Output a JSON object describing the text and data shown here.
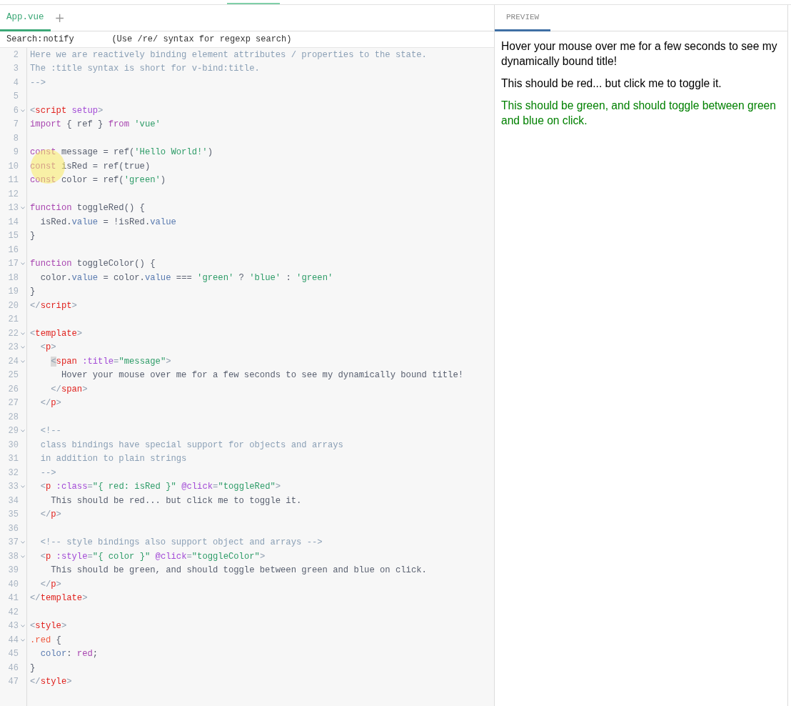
{
  "editor": {
    "tabs": [
      {
        "label": "App.vue",
        "selected": true
      }
    ],
    "add_tab": "+",
    "search": {
      "label": "Search:",
      "value": "notify",
      "hint": "(Use /re/ syntax for regexp search)"
    },
    "lines": [
      {
        "number": "2",
        "foldable": false,
        "tokens": [
          {
            "kind": "comment",
            "text": "Here we are reactively binding element attributes / properties to the state."
          }
        ]
      },
      {
        "number": "3",
        "foldable": false,
        "tokens": [
          {
            "kind": "comment",
            "text": "The :title syntax is short for v-bind:title."
          }
        ]
      },
      {
        "number": "4",
        "foldable": false,
        "tokens": [
          {
            "kind": "comment",
            "text": "-->"
          }
        ]
      },
      {
        "number": "5",
        "foldable": false
      },
      {
        "number": "6",
        "foldable": true,
        "tokens": [
          {
            "kind": "bracket",
            "text": "<"
          },
          {
            "kind": "tag",
            "text": "script"
          },
          {
            "kind": "attr",
            "text": " setup"
          },
          {
            "kind": "bracket",
            "text": ">"
          }
        ]
      },
      {
        "number": "7",
        "foldable": false,
        "tokens": [
          {
            "kind": "keyword",
            "text": "import"
          },
          {
            "kind": "plain",
            "text": " { ref } "
          },
          {
            "kind": "keyword",
            "text": "from"
          },
          {
            "kind": "string",
            "text": " 'vue'"
          }
        ]
      },
      {
        "number": "8",
        "foldable": false
      },
      {
        "number": "9",
        "foldable": false,
        "tokens": [
          {
            "kind": "keyword",
            "text": "const"
          },
          {
            "kind": "plain",
            "text": " message = ref("
          },
          {
            "kind": "string",
            "text": "'Hello World!'"
          },
          {
            "kind": "plain",
            "text": ")"
          }
        ]
      },
      {
        "number": "10",
        "foldable": false,
        "tokens": [
          {
            "kind": "keyword",
            "text": "const"
          },
          {
            "kind": "plain",
            "text": " isRed = ref(true)"
          }
        ]
      },
      {
        "number": "11",
        "foldable": false,
        "tokens": [
          {
            "kind": "keyword",
            "text": "const"
          },
          {
            "kind": "plain",
            "text": " color = ref("
          },
          {
            "kind": "string",
            "text": "'green'"
          },
          {
            "kind": "plain",
            "text": ")"
          }
        ]
      },
      {
        "number": "12",
        "foldable": false
      },
      {
        "number": "13",
        "foldable": true,
        "tokens": [
          {
            "kind": "keyword",
            "text": "function"
          },
          {
            "kind": "plain",
            "text": " toggleRed() {"
          }
        ]
      },
      {
        "number": "14",
        "foldable": false,
        "tokens": [
          {
            "kind": "plain",
            "text": "  isRed."
          },
          {
            "kind": "prop",
            "text": "value"
          },
          {
            "kind": "plain",
            "text": " = !isRed."
          },
          {
            "kind": "prop",
            "text": "value"
          }
        ]
      },
      {
        "number": "15",
        "foldable": false,
        "tokens": [
          {
            "kind": "plain",
            "text": "}"
          }
        ]
      },
      {
        "number": "16",
        "foldable": false
      },
      {
        "number": "17",
        "foldable": true,
        "tokens": [
          {
            "kind": "keyword",
            "text": "function"
          },
          {
            "kind": "plain",
            "text": " toggleColor() {"
          }
        ]
      },
      {
        "number": "18",
        "foldable": false,
        "tokens": [
          {
            "kind": "plain",
            "text": "  color."
          },
          {
            "kind": "prop",
            "text": "value"
          },
          {
            "kind": "plain",
            "text": " = color."
          },
          {
            "kind": "prop",
            "text": "value"
          },
          {
            "kind": "plain",
            "text": " === "
          },
          {
            "kind": "string",
            "text": "'green'"
          },
          {
            "kind": "plain",
            "text": " ? "
          },
          {
            "kind": "string",
            "text": "'blue'"
          },
          {
            "kind": "plain",
            "text": " : "
          },
          {
            "kind": "string",
            "text": "'green'"
          }
        ]
      },
      {
        "number": "19",
        "foldable": false,
        "tokens": [
          {
            "kind": "plain",
            "text": "}"
          }
        ]
      },
      {
        "number": "20",
        "foldable": false,
        "tokens": [
          {
            "kind": "bracket",
            "text": "</"
          },
          {
            "kind": "tag",
            "text": "script"
          },
          {
            "kind": "bracket",
            "text": ">"
          }
        ]
      },
      {
        "number": "21",
        "foldable": false
      },
      {
        "number": "22",
        "foldable": true,
        "tokens": [
          {
            "kind": "bracket",
            "text": "<"
          },
          {
            "kind": "tag",
            "text": "template"
          },
          {
            "kind": "bracket",
            "text": ">"
          }
        ]
      },
      {
        "number": "23",
        "foldable": true,
        "tokens": [
          {
            "kind": "bracket",
            "text": "  <"
          },
          {
            "kind": "tag",
            "text": "p"
          },
          {
            "kind": "bracket",
            "text": ">"
          }
        ]
      },
      {
        "number": "24",
        "foldable": true,
        "tokens": [
          {
            "kind": "match",
            "text": "    <"
          },
          {
            "kind": "tag",
            "text": "span"
          },
          {
            "kind": "attr",
            "text": " :title"
          },
          {
            "kind": "bracket",
            "text": "="
          },
          {
            "kind": "string",
            "text": "\"message\""
          },
          {
            "kind": "bracket",
            "text": ">"
          }
        ]
      },
      {
        "number": "25",
        "foldable": false,
        "tokens": [
          {
            "kind": "plain",
            "text": "      Hover your mouse over me for a few seconds to see my dynamically bound title!"
          }
        ]
      },
      {
        "number": "26",
        "foldable": false,
        "tokens": [
          {
            "kind": "bracket",
            "text": "    </"
          },
          {
            "kind": "tag",
            "text": "span"
          },
          {
            "kind": "bracket",
            "text": ">"
          }
        ]
      },
      {
        "number": "27",
        "foldable": false,
        "tokens": [
          {
            "kind": "bracket",
            "text": "  </"
          },
          {
            "kind": "tag",
            "text": "p"
          },
          {
            "kind": "bracket",
            "text": ">"
          }
        ]
      },
      {
        "number": "28",
        "foldable": false
      },
      {
        "number": "29",
        "foldable": true,
        "tokens": [
          {
            "kind": "comment",
            "text": "  <!--"
          }
        ]
      },
      {
        "number": "30",
        "foldable": false,
        "tokens": [
          {
            "kind": "comment",
            "text": "  class bindings have special support for objects and arrays"
          }
        ]
      },
      {
        "number": "31",
        "foldable": false,
        "tokens": [
          {
            "kind": "comment",
            "text": "  in addition to plain strings"
          }
        ]
      },
      {
        "number": "32",
        "foldable": false,
        "tokens": [
          {
            "kind": "comment",
            "text": "  -->"
          }
        ]
      },
      {
        "number": "33",
        "foldable": true,
        "tokens": [
          {
            "kind": "bracket",
            "text": "  <"
          },
          {
            "kind": "tag",
            "text": "p"
          },
          {
            "kind": "attr",
            "text": " :class"
          },
          {
            "kind": "bracket",
            "text": "="
          },
          {
            "kind": "string",
            "text": "\"{ red: isRed }\""
          },
          {
            "kind": "attr",
            "text": " @click"
          },
          {
            "kind": "bracket",
            "text": "="
          },
          {
            "kind": "string",
            "text": "\"toggleRed\""
          },
          {
            "kind": "bracket",
            "text": ">"
          }
        ]
      },
      {
        "number": "34",
        "foldable": false,
        "tokens": [
          {
            "kind": "plain",
            "text": "    This should be red... but click me to toggle it."
          }
        ]
      },
      {
        "number": "35",
        "foldable": false,
        "tokens": [
          {
            "kind": "bracket",
            "text": "  </"
          },
          {
            "kind": "tag",
            "text": "p"
          },
          {
            "kind": "bracket",
            "text": ">"
          }
        ]
      },
      {
        "number": "36",
        "foldable": false
      },
      {
        "number": "37",
        "foldable": true,
        "tokens": [
          {
            "kind": "comment",
            "text": "  <!-- style bindings also support object and arrays -->"
          }
        ]
      },
      {
        "number": "38",
        "foldable": true,
        "tokens": [
          {
            "kind": "bracket",
            "text": "  <"
          },
          {
            "kind": "tag",
            "text": "p"
          },
          {
            "kind": "attr",
            "text": " :style"
          },
          {
            "kind": "bracket",
            "text": "="
          },
          {
            "kind": "string",
            "text": "\"{ color }\""
          },
          {
            "kind": "attr",
            "text": " @click"
          },
          {
            "kind": "bracket",
            "text": "="
          },
          {
            "kind": "string",
            "text": "\"toggleColor\""
          },
          {
            "kind": "bracket",
            "text": ">"
          }
        ]
      },
      {
        "number": "39",
        "foldable": false,
        "tokens": [
          {
            "kind": "plain",
            "text": "    This should be green, and should toggle between green and blue on click."
          }
        ]
      },
      {
        "number": "40",
        "foldable": false,
        "tokens": [
          {
            "kind": "bracket",
            "text": "  </"
          },
          {
            "kind": "tag",
            "text": "p"
          },
          {
            "kind": "bracket",
            "text": ">"
          }
        ]
      },
      {
        "number": "41",
        "foldable": false,
        "tokens": [
          {
            "kind": "bracket",
            "text": "</"
          },
          {
            "kind": "tag",
            "text": "template"
          },
          {
            "kind": "bracket",
            "text": ">"
          }
        ]
      },
      {
        "number": "42",
        "foldable": false
      },
      {
        "number": "43",
        "foldable": true,
        "tokens": [
          {
            "kind": "bracket",
            "text": "<"
          },
          {
            "kind": "tag",
            "text": "style"
          },
          {
            "kind": "bracket",
            "text": ">"
          }
        ]
      },
      {
        "number": "44",
        "foldable": true,
        "tokens": [
          {
            "kind": "selector",
            "text": ".red"
          },
          {
            "kind": "plain",
            "text": " {"
          }
        ]
      },
      {
        "number": "45",
        "foldable": false,
        "tokens": [
          {
            "kind": "prop",
            "text": "  color"
          },
          {
            "kind": "plain",
            "text": ": "
          },
          {
            "kind": "keyword",
            "text": "red"
          },
          {
            "kind": "plain",
            "text": ";"
          }
        ]
      },
      {
        "number": "46",
        "foldable": false,
        "tokens": [
          {
            "kind": "plain",
            "text": "}"
          }
        ]
      },
      {
        "number": "47",
        "foldable": false,
        "tokens": [
          {
            "kind": "bracket",
            "text": "</"
          },
          {
            "kind": "tag",
            "text": "style"
          },
          {
            "kind": "bracket",
            "text": ">"
          }
        ]
      }
    ]
  },
  "preview": {
    "tabs": [
      {
        "label": "PREVIEW",
        "selected": true
      }
    ],
    "paragraphs": [
      {
        "text": "Hover your mouse over me for a few seconds to see my dynamically bound title!",
        "color": "#000000"
      },
      {
        "text": "This should be red... but click me to toggle it.",
        "color": "#000000"
      },
      {
        "text": "This should be green, and should toggle between green and blue on click.",
        "color": "#008000"
      }
    ]
  }
}
